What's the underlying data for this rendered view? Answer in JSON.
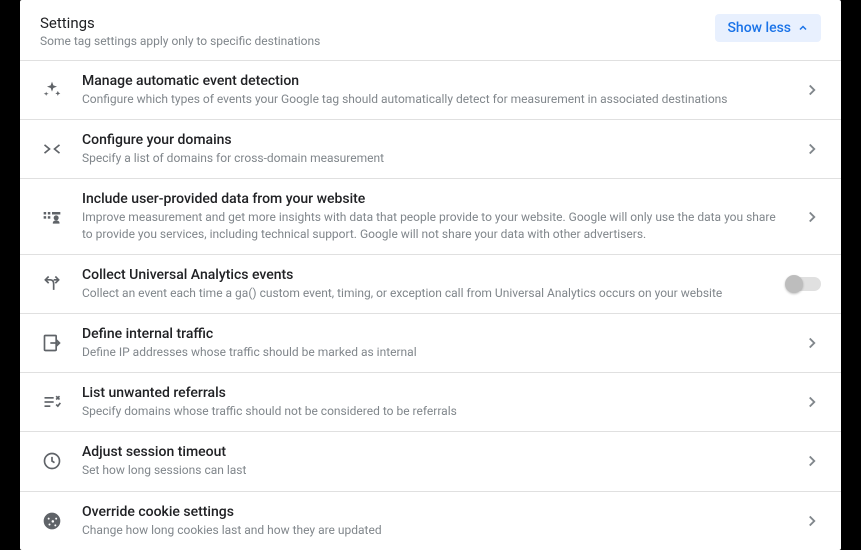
{
  "header": {
    "title": "Settings",
    "subtitle": "Some tag settings apply only to specific destinations",
    "toggle_label": "Show less"
  },
  "rows": [
    {
      "title": "Manage automatic event detection",
      "subtitle": "Configure which types of events your Google tag should automatically detect for measurement in associated destinations"
    },
    {
      "title": "Configure your domains",
      "subtitle": "Specify a list of domains for cross-domain measurement"
    },
    {
      "title": "Include user-provided data from your website",
      "subtitle": "Improve measurement and get more insights with data that people provide to your website. Google will only use the data you share to provide you services, including technical support. Google will not share your data with other advertisers."
    },
    {
      "title": "Collect Universal Analytics events",
      "subtitle": "Collect an event each time a ga() custom event, timing, or exception call from Universal Analytics occurs on your website"
    },
    {
      "title": "Define internal traffic",
      "subtitle": "Define IP addresses whose traffic should be marked as internal"
    },
    {
      "title": "List unwanted referrals",
      "subtitle": "Specify domains whose traffic should not be considered to be referrals"
    },
    {
      "title": "Adjust session timeout",
      "subtitle": "Set how long sessions can last"
    },
    {
      "title": "Override cookie settings",
      "subtitle": "Change how long cookies last and how they are updated"
    }
  ]
}
